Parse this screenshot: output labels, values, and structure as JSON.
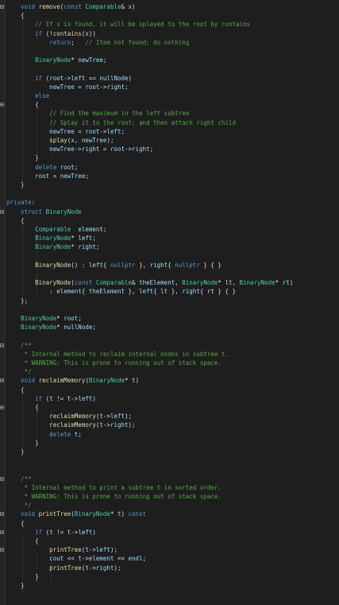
{
  "editor": {
    "language": "cpp",
    "colors": {
      "background": "#1e1e1e",
      "keyword": "#569cd6",
      "type": "#4ec9b0",
      "function": "#dcdcaa",
      "comment": "#57a64a",
      "parameter": "#9cdcfe",
      "text": "#dcdcdc"
    },
    "lines": [
      [
        {
          "k": "kw",
          "t": "    void "
        },
        {
          "k": "fn",
          "t": "remove"
        },
        {
          "k": "tx",
          "t": "("
        },
        {
          "k": "kw",
          "t": "const "
        },
        {
          "k": "ty",
          "t": "Comparable"
        },
        {
          "k": "tx",
          "t": "& "
        },
        {
          "k": "pr",
          "t": "x"
        },
        {
          "k": "tx",
          "t": ")"
        }
      ],
      [
        {
          "k": "tx",
          "t": "    {"
        }
      ],
      [
        {
          "k": "cm",
          "t": "        // If x is found, it will be splayed to the root by contains"
        }
      ],
      [
        {
          "k": "kw",
          "t": "        if "
        },
        {
          "k": "tx",
          "t": "(!"
        },
        {
          "k": "fn",
          "t": "contains"
        },
        {
          "k": "tx",
          "t": "("
        },
        {
          "k": "pr",
          "t": "x"
        },
        {
          "k": "tx",
          "t": "))"
        }
      ],
      [
        {
          "k": "kw",
          "t": "            return"
        },
        {
          "k": "tx",
          "t": ";   "
        },
        {
          "k": "cm",
          "t": "// Item not found; do nothing"
        }
      ],
      [
        {
          "k": "tx",
          "t": ""
        }
      ],
      [
        {
          "k": "ty",
          "t": "        BinaryNode"
        },
        {
          "k": "tx",
          "t": "* "
        },
        {
          "k": "pr",
          "t": "newTree"
        },
        {
          "k": "tx",
          "t": ";"
        }
      ],
      [
        {
          "k": "tx",
          "t": ""
        }
      ],
      [
        {
          "k": "kw",
          "t": "        if "
        },
        {
          "k": "tx",
          "t": "("
        },
        {
          "k": "pr",
          "t": "root"
        },
        {
          "k": "tx",
          "t": "->"
        },
        {
          "k": "pr",
          "t": "left"
        },
        {
          "k": "tx",
          "t": " == "
        },
        {
          "k": "pr",
          "t": "nullNode"
        },
        {
          "k": "tx",
          "t": ")"
        }
      ],
      [
        {
          "k": "pr",
          "t": "            newTree"
        },
        {
          "k": "tx",
          "t": " = "
        },
        {
          "k": "pr",
          "t": "root"
        },
        {
          "k": "tx",
          "t": "->"
        },
        {
          "k": "pr",
          "t": "right"
        },
        {
          "k": "tx",
          "t": ";"
        }
      ],
      [
        {
          "k": "kw",
          "t": "        else"
        }
      ],
      [
        {
          "k": "tx",
          "t": "        {"
        }
      ],
      [
        {
          "k": "cm",
          "t": "            // Find the maximum in the left subtree"
        }
      ],
      [
        {
          "k": "cm",
          "t": "            // Splay it to the root; and then attach right child"
        }
      ],
      [
        {
          "k": "pr",
          "t": "            newTree"
        },
        {
          "k": "tx",
          "t": " = "
        },
        {
          "k": "pr",
          "t": "root"
        },
        {
          "k": "tx",
          "t": "->"
        },
        {
          "k": "pr",
          "t": "left"
        },
        {
          "k": "tx",
          "t": ";"
        }
      ],
      [
        {
          "k": "fn",
          "t": "            splay"
        },
        {
          "k": "tx",
          "t": "("
        },
        {
          "k": "pr",
          "t": "x"
        },
        {
          "k": "tx",
          "t": ", "
        },
        {
          "k": "pr",
          "t": "newTree"
        },
        {
          "k": "tx",
          "t": ");"
        }
      ],
      [
        {
          "k": "pr",
          "t": "            newTree"
        },
        {
          "k": "tx",
          "t": "->"
        },
        {
          "k": "pr",
          "t": "right"
        },
        {
          "k": "tx",
          "t": " = "
        },
        {
          "k": "pr",
          "t": "root"
        },
        {
          "k": "tx",
          "t": "->"
        },
        {
          "k": "pr",
          "t": "right"
        },
        {
          "k": "tx",
          "t": ";"
        }
      ],
      [
        {
          "k": "tx",
          "t": "        }"
        }
      ],
      [
        {
          "k": "kw",
          "t": "        delete "
        },
        {
          "k": "pr",
          "t": "root"
        },
        {
          "k": "tx",
          "t": ";"
        }
      ],
      [
        {
          "k": "pr",
          "t": "        root"
        },
        {
          "k": "tx",
          "t": " = "
        },
        {
          "k": "pr",
          "t": "newTree"
        },
        {
          "k": "tx",
          "t": ";"
        }
      ],
      [
        {
          "k": "tx",
          "t": "    }"
        }
      ],
      [
        {
          "k": "tx",
          "t": ""
        }
      ],
      [
        {
          "k": "kw",
          "t": "private"
        },
        {
          "k": "tx",
          "t": ":"
        }
      ],
      [
        {
          "k": "kw",
          "t": "    struct "
        },
        {
          "k": "ty",
          "t": "BinaryNode"
        }
      ],
      [
        {
          "k": "tx",
          "t": "    {"
        }
      ],
      [
        {
          "k": "ty",
          "t": "        Comparable"
        },
        {
          "k": "tx",
          "t": "  "
        },
        {
          "k": "pr",
          "t": "element"
        },
        {
          "k": "tx",
          "t": ";"
        }
      ],
      [
        {
          "k": "ty",
          "t": "        BinaryNode"
        },
        {
          "k": "tx",
          "t": "* "
        },
        {
          "k": "pr",
          "t": "left"
        },
        {
          "k": "tx",
          "t": ";"
        }
      ],
      [
        {
          "k": "ty",
          "t": "        BinaryNode"
        },
        {
          "k": "tx",
          "t": "* "
        },
        {
          "k": "pr",
          "t": "right"
        },
        {
          "k": "tx",
          "t": ";"
        }
      ],
      [
        {
          "k": "tx",
          "t": ""
        }
      ],
      [
        {
          "k": "fn",
          "t": "        BinaryNode"
        },
        {
          "k": "tx",
          "t": "() : "
        },
        {
          "k": "pr",
          "t": "left"
        },
        {
          "k": "tx",
          "t": "{ "
        },
        {
          "k": "np",
          "t": "nullptr"
        },
        {
          "k": "tx",
          "t": " }, "
        },
        {
          "k": "pr",
          "t": "right"
        },
        {
          "k": "tx",
          "t": "{ "
        },
        {
          "k": "np",
          "t": "nullptr"
        },
        {
          "k": "tx",
          "t": " } { }"
        }
      ],
      [
        {
          "k": "tx",
          "t": ""
        }
      ],
      [
        {
          "k": "fn",
          "t": "        BinaryNode"
        },
        {
          "k": "tx",
          "t": "("
        },
        {
          "k": "kw",
          "t": "const "
        },
        {
          "k": "ty",
          "t": "Comparable"
        },
        {
          "k": "tx",
          "t": "& "
        },
        {
          "k": "pr",
          "t": "theElement"
        },
        {
          "k": "tx",
          "t": ", "
        },
        {
          "k": "ty",
          "t": "BinaryNode"
        },
        {
          "k": "tx",
          "t": "* "
        },
        {
          "k": "pr",
          "t": "lt"
        },
        {
          "k": "tx",
          "t": ", "
        },
        {
          "k": "ty",
          "t": "BinaryNode"
        },
        {
          "k": "tx",
          "t": "* "
        },
        {
          "k": "pr",
          "t": "rt"
        },
        {
          "k": "tx",
          "t": ")"
        }
      ],
      [
        {
          "k": "tx",
          "t": "            : "
        },
        {
          "k": "pr",
          "t": "element"
        },
        {
          "k": "tx",
          "t": "{ "
        },
        {
          "k": "pr",
          "t": "theElement"
        },
        {
          "k": "tx",
          "t": " }, "
        },
        {
          "k": "pr",
          "t": "left"
        },
        {
          "k": "tx",
          "t": "{ "
        },
        {
          "k": "pr",
          "t": "lt"
        },
        {
          "k": "tx",
          "t": " }, "
        },
        {
          "k": "pr",
          "t": "right"
        },
        {
          "k": "tx",
          "t": "{ "
        },
        {
          "k": "pr",
          "t": "rt"
        },
        {
          "k": "tx",
          "t": " } { }"
        }
      ],
      [
        {
          "k": "tx",
          "t": "    };"
        }
      ],
      [
        {
          "k": "tx",
          "t": ""
        }
      ],
      [
        {
          "k": "ty",
          "t": "    BinaryNode"
        },
        {
          "k": "tx",
          "t": "* "
        },
        {
          "k": "pr",
          "t": "root"
        },
        {
          "k": "tx",
          "t": ";"
        }
      ],
      [
        {
          "k": "ty",
          "t": "    BinaryNode"
        },
        {
          "k": "tx",
          "t": "* "
        },
        {
          "k": "pr",
          "t": "nullNode"
        },
        {
          "k": "tx",
          "t": ";"
        }
      ],
      [
        {
          "k": "tx",
          "t": ""
        }
      ],
      [
        {
          "k": "cm",
          "t": "    /**"
        }
      ],
      [
        {
          "k": "cm",
          "t": "     * Internal method to reclaim internal nodes in subtree t."
        }
      ],
      [
        {
          "k": "cm",
          "t": "     * WARNING: This is prone to running out of stack space."
        }
      ],
      [
        {
          "k": "cm",
          "t": "     */"
        }
      ],
      [
        {
          "k": "kw",
          "t": "    void "
        },
        {
          "k": "fn",
          "t": "reclaimMemory"
        },
        {
          "k": "tx",
          "t": "("
        },
        {
          "k": "ty",
          "t": "BinaryNode"
        },
        {
          "k": "tx",
          "t": "* "
        },
        {
          "k": "pr",
          "t": "t"
        },
        {
          "k": "tx",
          "t": ")"
        }
      ],
      [
        {
          "k": "tx",
          "t": "    {"
        }
      ],
      [
        {
          "k": "kw",
          "t": "        if "
        },
        {
          "k": "tx",
          "t": "("
        },
        {
          "k": "pr",
          "t": "t"
        },
        {
          "k": "tx",
          "t": " != "
        },
        {
          "k": "pr",
          "t": "t"
        },
        {
          "k": "tx",
          "t": "->"
        },
        {
          "k": "pr",
          "t": "left"
        },
        {
          "k": "tx",
          "t": ")"
        }
      ],
      [
        {
          "k": "tx",
          "t": "        {"
        }
      ],
      [
        {
          "k": "fn",
          "t": "            reclaimMemory"
        },
        {
          "k": "tx",
          "t": "("
        },
        {
          "k": "pr",
          "t": "t"
        },
        {
          "k": "tx",
          "t": "->"
        },
        {
          "k": "pr",
          "t": "left"
        },
        {
          "k": "tx",
          "t": ");"
        }
      ],
      [
        {
          "k": "fn",
          "t": "            reclaimMemory"
        },
        {
          "k": "tx",
          "t": "("
        },
        {
          "k": "pr",
          "t": "t"
        },
        {
          "k": "tx",
          "t": "->"
        },
        {
          "k": "pr",
          "t": "right"
        },
        {
          "k": "tx",
          "t": ");"
        }
      ],
      [
        {
          "k": "kw",
          "t": "            delete "
        },
        {
          "k": "pr",
          "t": "t"
        },
        {
          "k": "tx",
          "t": ";"
        }
      ],
      [
        {
          "k": "tx",
          "t": "        }"
        }
      ],
      [
        {
          "k": "tx",
          "t": "    }"
        }
      ],
      [
        {
          "k": "tx",
          "t": ""
        }
      ],
      [
        {
          "k": "tx",
          "t": ""
        }
      ],
      [
        {
          "k": "cm",
          "t": "    /**"
        }
      ],
      [
        {
          "k": "cm",
          "t": "     * Internal method to print a subtree t in sorted order."
        }
      ],
      [
        {
          "k": "cm",
          "t": "     * WARNING: This is prone to running out of stack space."
        }
      ],
      [
        {
          "k": "cm",
          "t": "     */"
        }
      ],
      [
        {
          "k": "kw",
          "t": "    void "
        },
        {
          "k": "fn",
          "t": "printTree"
        },
        {
          "k": "tx",
          "t": "("
        },
        {
          "k": "ty",
          "t": "BinaryNode"
        },
        {
          "k": "tx",
          "t": "* "
        },
        {
          "k": "pr",
          "t": "t"
        },
        {
          "k": "tx",
          "t": ") "
        },
        {
          "k": "kw",
          "t": "const"
        }
      ],
      [
        {
          "k": "tx",
          "t": "    {"
        }
      ],
      [
        {
          "k": "kw",
          "t": "        if "
        },
        {
          "k": "tx",
          "t": "("
        },
        {
          "k": "pr",
          "t": "t"
        },
        {
          "k": "tx",
          "t": " != "
        },
        {
          "k": "pr",
          "t": "t"
        },
        {
          "k": "tx",
          "t": "->"
        },
        {
          "k": "pr",
          "t": "left"
        },
        {
          "k": "tx",
          "t": ")"
        }
      ],
      [
        {
          "k": "tx",
          "t": "        {"
        }
      ],
      [
        {
          "k": "fn",
          "t": "            printTree"
        },
        {
          "k": "tx",
          "t": "("
        },
        {
          "k": "pr",
          "t": "t"
        },
        {
          "k": "tx",
          "t": "->"
        },
        {
          "k": "pr",
          "t": "left"
        },
        {
          "k": "tx",
          "t": ");"
        }
      ],
      [
        {
          "k": "pr",
          "t": "            cout"
        },
        {
          "k": "tx",
          "t": " << "
        },
        {
          "k": "pr",
          "t": "t"
        },
        {
          "k": "tx",
          "t": "->"
        },
        {
          "k": "pr",
          "t": "element"
        },
        {
          "k": "tx",
          "t": " << "
        },
        {
          "k": "pr",
          "t": "endl"
        },
        {
          "k": "tx",
          "t": ";"
        }
      ],
      [
        {
          "k": "fn",
          "t": "            printTree"
        },
        {
          "k": "tx",
          "t": "("
        },
        {
          "k": "pr",
          "t": "t"
        },
        {
          "k": "tx",
          "t": "->"
        },
        {
          "k": "pr",
          "t": "right"
        },
        {
          "k": "tx",
          "t": ");"
        }
      ],
      [
        {
          "k": "tx",
          "t": "        }"
        }
      ],
      [
        {
          "k": "tx",
          "t": "    }"
        }
      ]
    ],
    "folds": [
      0,
      11,
      23,
      38,
      42,
      45,
      53,
      57,
      59,
      61
    ]
  }
}
